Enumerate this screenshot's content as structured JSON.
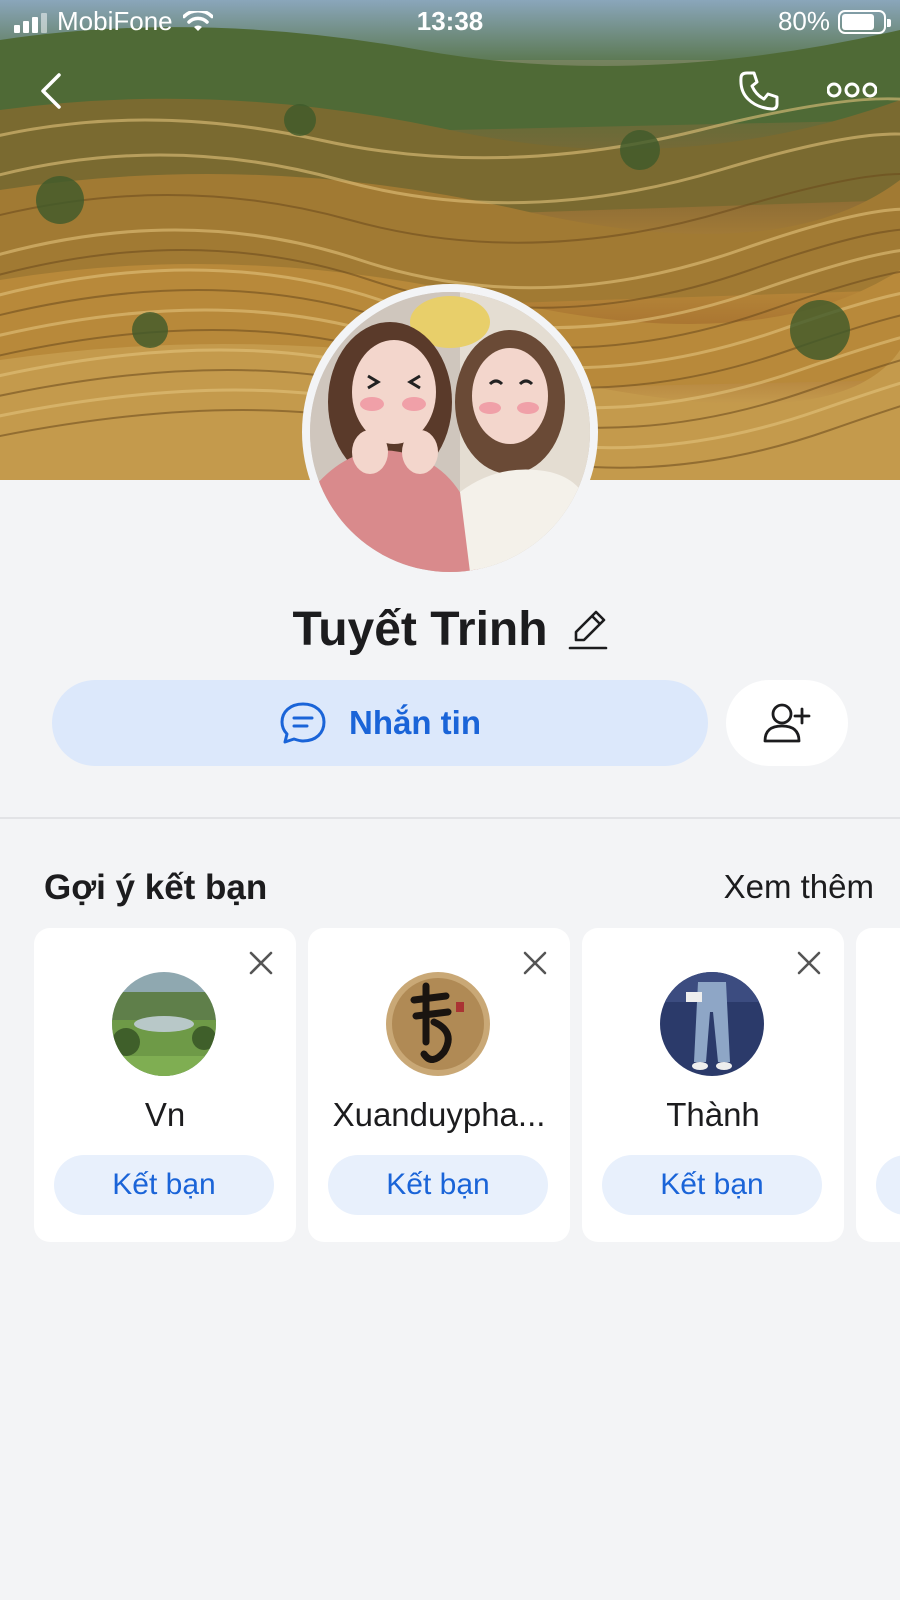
{
  "status_bar": {
    "carrier": "MobiFone",
    "time": "13:38",
    "battery": "80%",
    "battery_level": 0.8
  },
  "nav": {
    "back_icon": "chevron-left-icon",
    "call_icon": "phone-icon",
    "more_icon": "more-horizontal-icon"
  },
  "profile": {
    "name": "Tuyết Trinh",
    "edit_icon": "pencil-icon"
  },
  "actions": {
    "message_label": "Nhắn tin",
    "message_icon": "chat-bubble-icon",
    "add_friend_icon": "user-plus-icon"
  },
  "suggestions": {
    "title": "Gợi ý kết bạn",
    "see_more": "Xem thêm",
    "items": [
      {
        "name": "Vn",
        "button": "Kết bạn"
      },
      {
        "name": "Xuanduypha...",
        "button": "Kết bạn"
      },
      {
        "name": "Thành",
        "button": "Kết bạn"
      }
    ]
  },
  "colors": {
    "accent": "#1a64d8",
    "accent_bg": "#dce8fb",
    "page_bg": "#f3f4f6"
  }
}
